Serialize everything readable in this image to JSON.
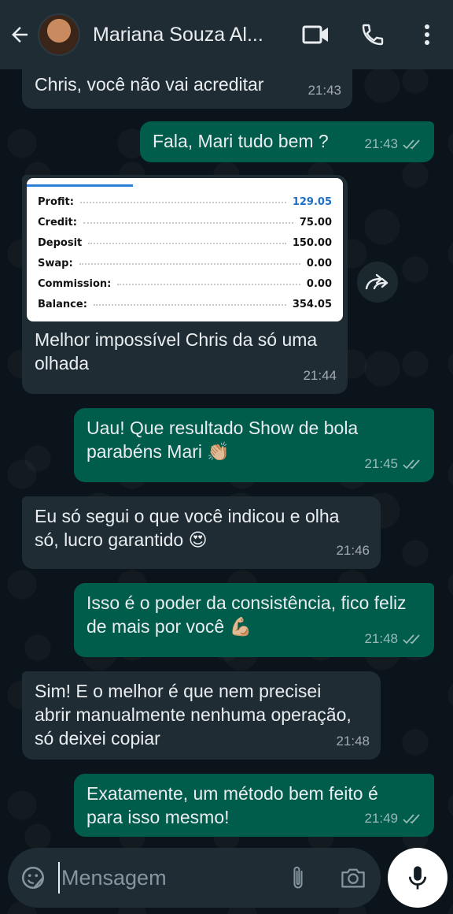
{
  "header": {
    "contact_name": "Mariana Souza Al...",
    "icons": [
      "back-arrow-icon",
      "video-call-icon",
      "phone-icon",
      "more-vert-icon"
    ]
  },
  "messages": [
    {
      "dir": "in",
      "text": "Chris, você não vai acreditar",
      "time": "21:43"
    },
    {
      "dir": "out",
      "text": "Fala, Mari tudo bem ?",
      "time": "21:43",
      "status": "read"
    },
    {
      "dir": "in",
      "image": true,
      "text": "Melhor impossível Chris da só uma olhada",
      "time": "21:44"
    },
    {
      "dir": "out",
      "text": "Uau! Que resultado Show de bola parabéns Mari 👏🏼",
      "time": "21:45",
      "status": "read"
    },
    {
      "dir": "in",
      "text": "Eu só segui o que você indicou e olha só, lucro garantido 😍",
      "time": "21:46"
    },
    {
      "dir": "out",
      "text": "Isso é o poder da consistência, fico feliz de mais por você 💪🏼",
      "time": "21:48",
      "status": "read"
    },
    {
      "dir": "in",
      "text": "Sim! E o melhor é que nem precisei abrir manualmente nenhuma operação, só deixei copiar",
      "time": "21:48"
    },
    {
      "dir": "out",
      "text": "Exatamente, um método bem feito é para isso mesmo!",
      "time": "21:49",
      "status": "read"
    }
  ],
  "trade_summary": [
    {
      "label": "Profit:",
      "value": "129.05"
    },
    {
      "label": "Credit:",
      "value": "75.00"
    },
    {
      "label": "Deposit",
      "value": "150.00"
    },
    {
      "label": "Swap:",
      "value": "0.00"
    },
    {
      "label": "Commission:",
      "value": "0.00"
    },
    {
      "label": "Balance:",
      "value": "354.05"
    }
  ],
  "input": {
    "placeholder": "Mensagem"
  },
  "colors": {
    "header_bg": "#1f2c33",
    "incoming_bubble": "#1f2c33",
    "outgoing_bubble": "#005c4b",
    "profit_value": "#1f6fc5"
  }
}
